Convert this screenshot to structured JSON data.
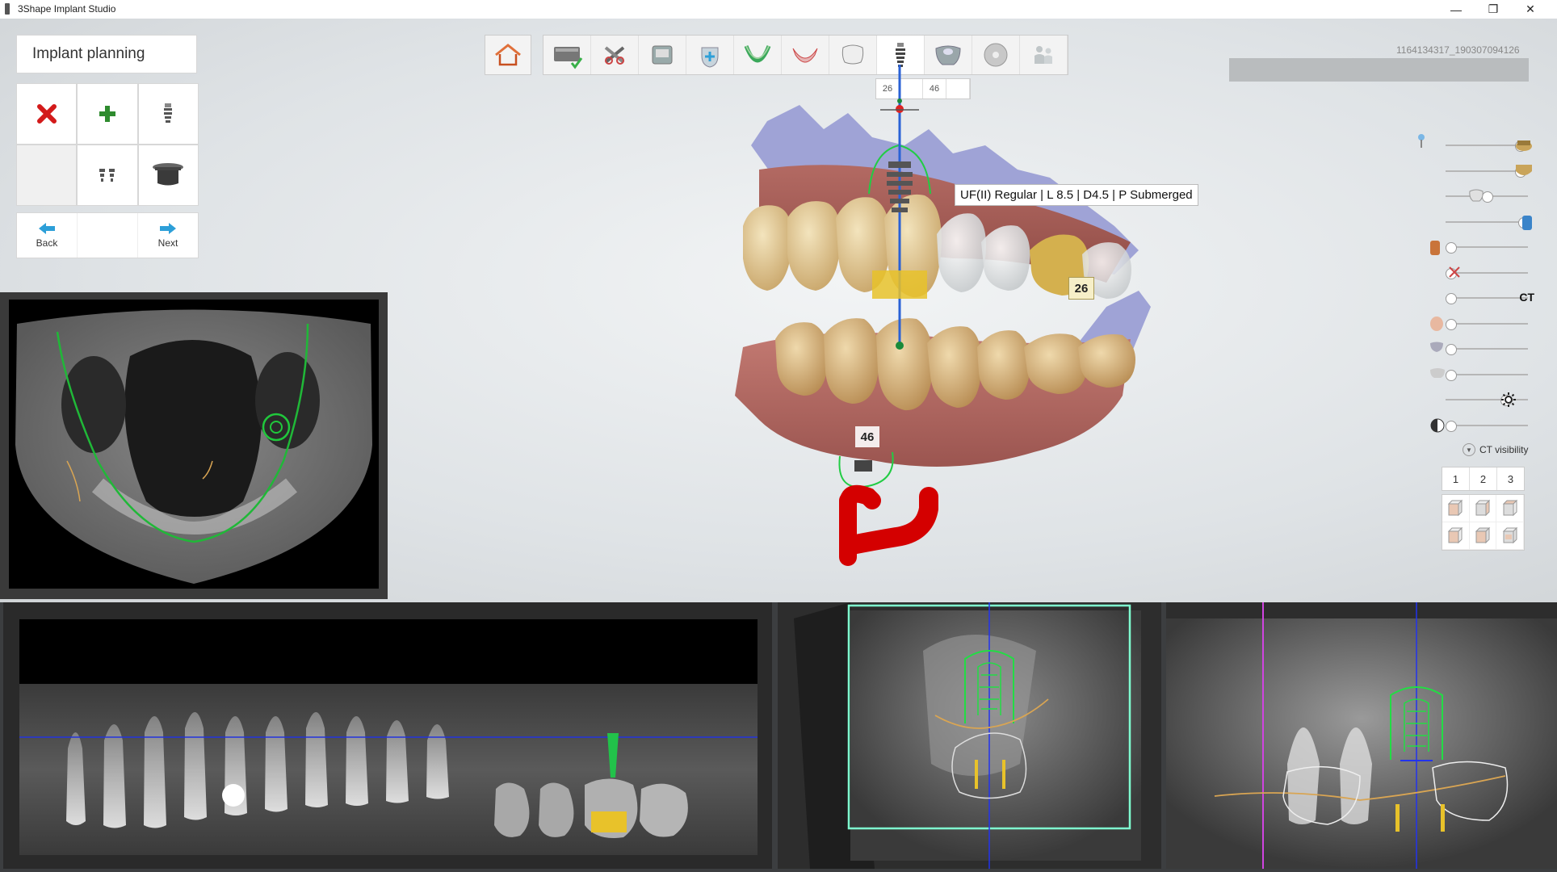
{
  "window": {
    "title": "3Shape Implant Studio",
    "minimize": "—",
    "restore": "❐",
    "close": "✕"
  },
  "panel": {
    "title": "Implant planning",
    "tools": [
      "delete-implant-icon",
      "add-implant-icon",
      "implant-icon",
      "empty",
      "multi-implant-icon",
      "sleeve-icon"
    ],
    "back_label": "Back",
    "next_label": "Next"
  },
  "workflow": {
    "steps": [
      "order-form",
      "scan-settings",
      "ct-import",
      "alignment",
      "nerve",
      "crown-bridge",
      "tooth-model",
      "implant-planning",
      "guide-design",
      "export",
      "patient"
    ],
    "active_step": "implant-planning",
    "teeth_tabs": [
      "26",
      "46",
      ""
    ]
  },
  "case": {
    "id": "1164134317_190307094126"
  },
  "scene": {
    "tooltip": "UF(II) Regular | L 8.5 | D4.5 | P Submerged",
    "tooth_label_upper": "26",
    "tooth_label_lower": "46"
  },
  "visibility": {
    "ct_text": "CT",
    "ct_visibility_label": "CT visibility",
    "view_numbers": [
      "1",
      "2",
      "3"
    ],
    "slider_levels": [
      0.95,
      0.95,
      0.5,
      1.0,
      0.0,
      0.0,
      0.0,
      0.0,
      0.0,
      0.0,
      0.75,
      0.0
    ]
  },
  "colors": {
    "accent_blue": "#2d9fd8",
    "implant_green": "#2ecc55",
    "nerve_red": "#d40000",
    "plan_curve": "#1fbf3a",
    "tooth_yellow": "#e8c22a"
  }
}
